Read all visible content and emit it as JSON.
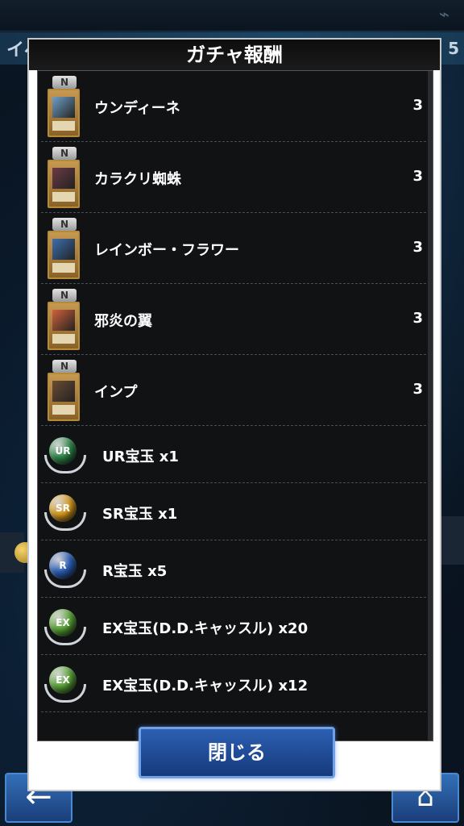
{
  "background": {
    "header_text": "イベ",
    "header_number": "5"
  },
  "dialog": {
    "title": "ガチャ報酬",
    "close_label": "閉じる"
  },
  "cards": [
    {
      "rarity": "N",
      "name": "ウンディーネ",
      "qty": "3",
      "art_color": "#6fa0c8"
    },
    {
      "rarity": "N",
      "name": "カラクリ蜘蛛",
      "qty": "3",
      "art_color": "#6b3a44"
    },
    {
      "rarity": "N",
      "name": "レインボー・フラワー",
      "qty": "3",
      "art_color": "#3c6fb0"
    },
    {
      "rarity": "N",
      "name": "邪炎の翼",
      "qty": "3",
      "art_color": "#d0613a"
    },
    {
      "rarity": "N",
      "name": "インプ",
      "qty": "3",
      "art_color": "#6a4b32"
    }
  ],
  "orbs": [
    {
      "label": "UR",
      "name": "UR宝玉 x1",
      "color": "#2f8a4a"
    },
    {
      "label": "SR",
      "name": "SR宝玉 x1",
      "color": "#d89a1c"
    },
    {
      "label": "R",
      "name": "R宝玉 x5",
      "color": "#2a5fb8"
    },
    {
      "label": "EX",
      "name": "EX宝玉(D.D.キャッスル) x20",
      "color": "#5aa636"
    },
    {
      "label": "EX",
      "name": "EX宝玉(D.D.キャッスル) x12",
      "color": "#5aa636"
    }
  ]
}
